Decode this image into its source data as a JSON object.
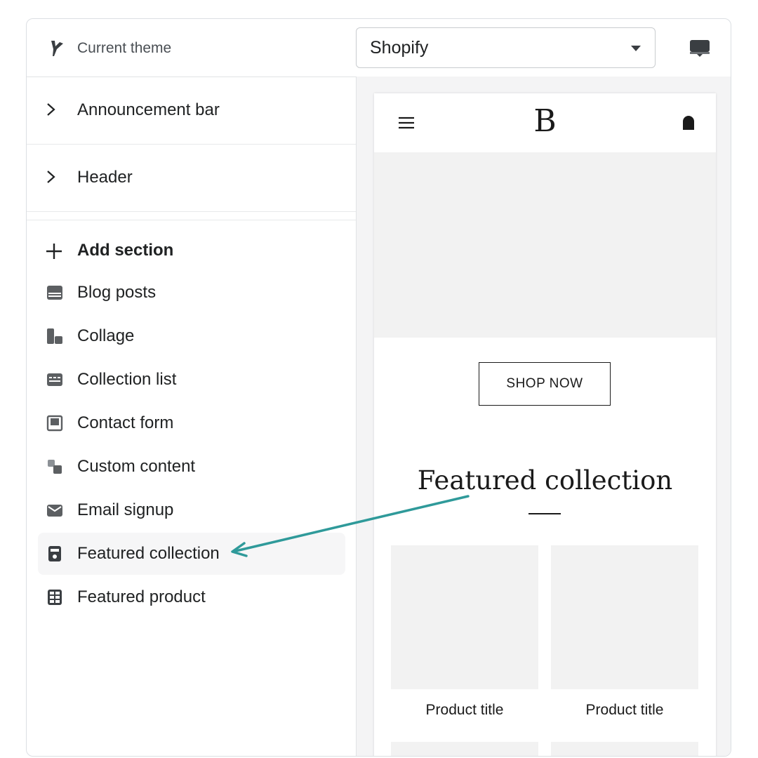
{
  "topbar": {
    "theme_label": "Current theme",
    "theme_icon": "brush-icon",
    "theme_select_value": "Shopify",
    "device_icon": "desktop-icon"
  },
  "sidebar": {
    "nav_rows": [
      {
        "label": "Announcement bar",
        "icon": "chevron-right-icon"
      },
      {
        "label": "Header",
        "icon": "chevron-right-icon"
      }
    ],
    "add_section_label": "Add section",
    "sections": [
      {
        "label": "Blog posts",
        "icon": "blog-posts-icon"
      },
      {
        "label": "Collage",
        "icon": "collage-icon"
      },
      {
        "label": "Collection list",
        "icon": "collection-list-icon"
      },
      {
        "label": "Contact form",
        "icon": "contact-form-icon"
      },
      {
        "label": "Custom content",
        "icon": "custom-content-icon"
      },
      {
        "label": "Email signup",
        "icon": "email-icon"
      },
      {
        "label": "Featured collection",
        "icon": "featured-collection-icon",
        "active": true
      },
      {
        "label": "Featured product",
        "icon": "featured-product-icon"
      }
    ]
  },
  "preview": {
    "logo": "B",
    "shop_button": "SHOP NOW",
    "featured_title": "Featured collection",
    "products": [
      {
        "title": "Product title"
      },
      {
        "title": "Product title"
      }
    ]
  },
  "colors": {
    "accent_arrow": "#2f9a9a",
    "text": "#202223",
    "placeholder": "#f2f2f2"
  }
}
